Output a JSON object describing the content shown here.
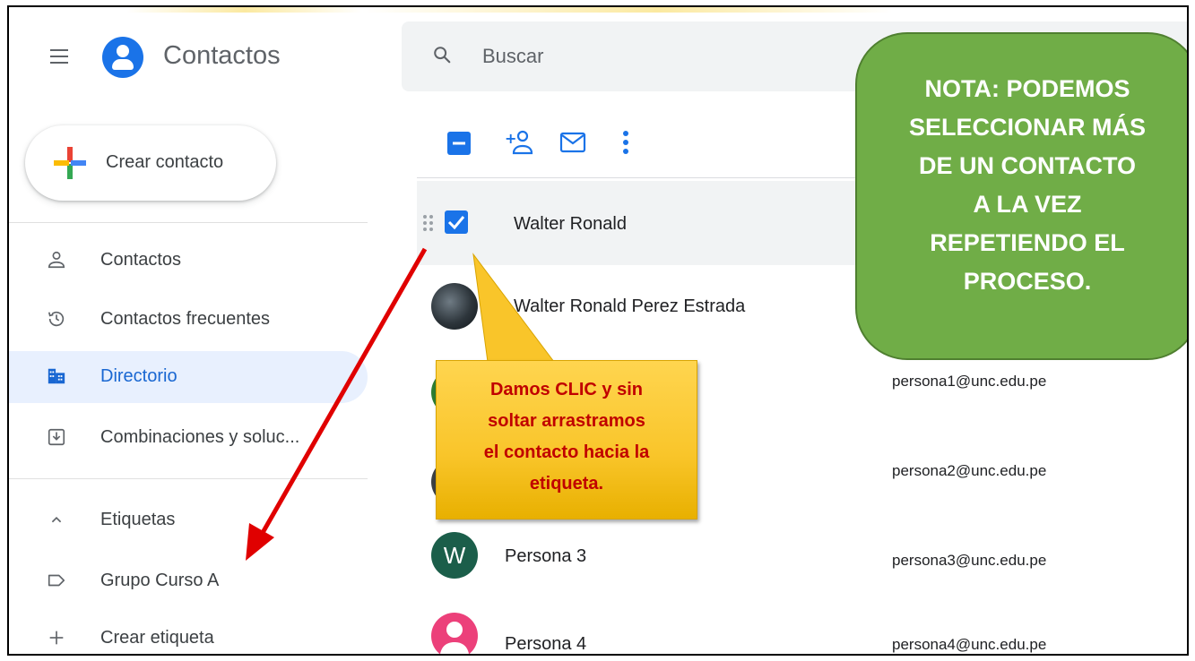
{
  "header": {
    "app_title": "Contactos",
    "search_placeholder": "Buscar"
  },
  "sidebar": {
    "create_label": "Crear contacto",
    "items": [
      {
        "label": "Contactos",
        "icon": "person-icon"
      },
      {
        "label": "Contactos frecuentes",
        "icon": "history-icon"
      },
      {
        "label": "Directorio",
        "icon": "directory-icon",
        "active": true
      },
      {
        "label": "Combinaciones y soluc...",
        "icon": "merge-icon"
      }
    ],
    "labels_header": "Etiquetas",
    "labels": [
      {
        "label": "Grupo Curso A",
        "icon": "label-icon"
      }
    ],
    "create_label_action": "Crear etiqueta"
  },
  "toolbar": {
    "icons": [
      "deselect-checkbox-icon",
      "add-to-contacts-icon",
      "email-icon",
      "more-vert-icon"
    ]
  },
  "contacts": [
    {
      "name": "Walter Ronald",
      "email": "",
      "selected": true
    },
    {
      "name": "Walter Ronald Perez Estrada",
      "email": ""
    },
    {
      "name": "",
      "email": "persona1@unc.edu.pe"
    },
    {
      "name": "",
      "email": "persona2@unc.edu.pe"
    },
    {
      "name": "Persona 3",
      "email": "persona3@unc.edu.pe",
      "initial": "W"
    },
    {
      "name": "Persona 4",
      "email": "persona4@unc.edu.pe"
    }
  ],
  "notes": {
    "green_lines": [
      "NOTA: PODEMOS",
      "SELECCIONAR MÁS",
      "DE UN CONTACTO",
      "A LA VEZ",
      "REPETIENDO EL",
      "PROCESO."
    ],
    "yellow_lines": [
      "Damos CLIC y sin",
      "soltar arrastramos",
      "el contacto hacia la",
      "etiqueta."
    ]
  },
  "colors": {
    "accent": "#1a73e8",
    "green_note": "#70ad47",
    "yellow_note": "#f9c52a",
    "note_text_red": "#c00000",
    "arrow": "#e00000"
  }
}
